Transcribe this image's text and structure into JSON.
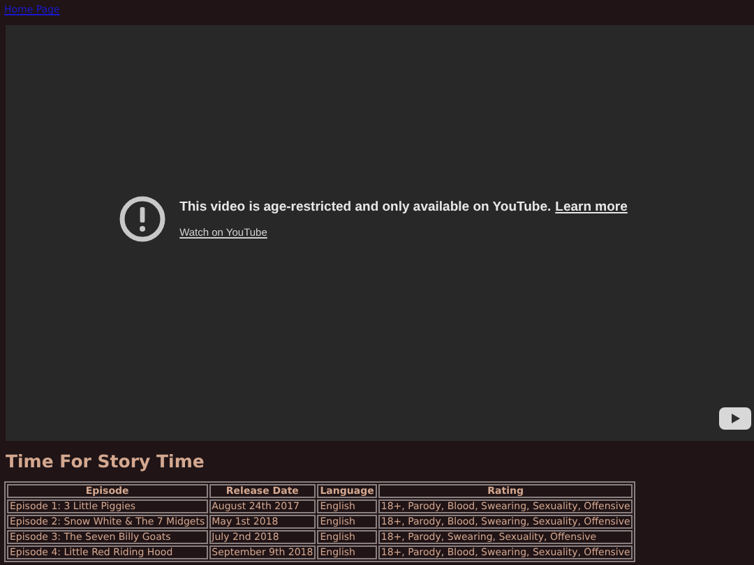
{
  "nav_link": "Home Page",
  "video": {
    "message": "This video is age-restricted and only available on YouTube.",
    "learn_more": "Learn more",
    "watch_link": "Watch on YouTube"
  },
  "title": "Time For Story Time",
  "table": {
    "columns": [
      "Episode",
      "Release Date",
      "Language",
      "Rating"
    ],
    "rows": [
      [
        "Episode 1: 3 Little Piggies",
        "August 24th 2017",
        "English",
        "18+, Parody, Blood, Swearing, Sexuality, Offensive"
      ],
      [
        "Episode 2: Snow White & The 7 Midgets",
        "May 1st 2018",
        "English",
        "18+, Parody, Blood, Swearing, Sexuality, Offensive"
      ],
      [
        "Episode 3: The Seven Billy Goats",
        "July 2nd 2018",
        "English",
        "18+, Parody, Swearing, Sexuality, Offensive"
      ],
      [
        "Episode 4: Little Red Riding Hood",
        "September 9th 2018",
        "English",
        "18+, Parody, Blood, Swearing, Sexuality, Offensive"
      ]
    ]
  }
}
